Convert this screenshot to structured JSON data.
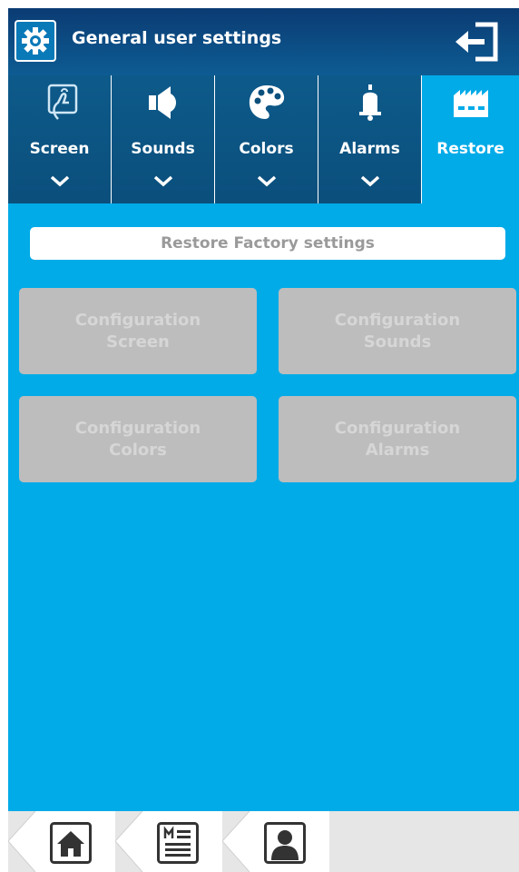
{
  "header": {
    "title": "General user settings",
    "settings_icon": "gear-icon",
    "exit_icon": "exit-icon"
  },
  "tabs": [
    {
      "label": "Screen",
      "icon": "touch-screen-icon",
      "active": false
    },
    {
      "label": "Sounds",
      "icon": "speaker-icon",
      "active": false
    },
    {
      "label": "Colors",
      "icon": "palette-icon",
      "active": false
    },
    {
      "label": "Alarms",
      "icon": "bell-icon",
      "active": false
    },
    {
      "label": "Restore",
      "icon": "factory-icon",
      "active": true
    }
  ],
  "content": {
    "restore_title": "Restore Factory settings",
    "buttons": [
      {
        "line1": "Configuration",
        "line2": "Screen"
      },
      {
        "line1": "Configuration",
        "line2": "Sounds"
      },
      {
        "line1": "Configuration",
        "line2": "Colors"
      },
      {
        "line1": "Configuration",
        "line2": "Alarms"
      }
    ]
  },
  "bottom_nav": [
    {
      "icon": "home-icon"
    },
    {
      "icon": "menu-icon"
    },
    {
      "icon": "user-profile-icon"
    }
  ],
  "colors": {
    "background": "#00abe8",
    "header": "#0b4f7c",
    "button_disabled": "#bdbdbd",
    "nav_bar": "#e6e6e6"
  }
}
